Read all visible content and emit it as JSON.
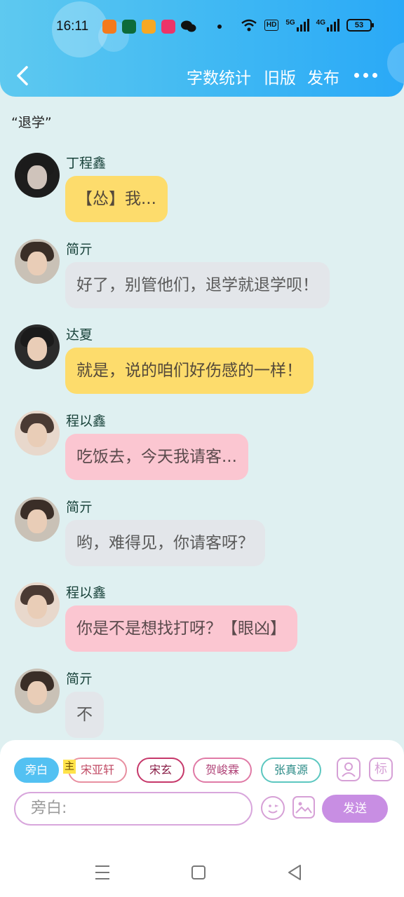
{
  "status_bar": {
    "time": "16:11",
    "network_5g": "5G",
    "network_4g": "4G",
    "hd": "HD",
    "battery": "53"
  },
  "header": {
    "word_count": "字数统计",
    "old_version": "旧版",
    "publish": "发布"
  },
  "chat_title": "“退学”",
  "messages": [
    {
      "sender": "丁程鑫",
      "text": "【怂】我...",
      "color": "yellow"
    },
    {
      "sender": "简亓",
      "text": "好了，别管他们，退学就退学呗！",
      "color": "gray"
    },
    {
      "sender": "达夏",
      "text": "就是，说的咱们好伤感的一样！",
      "color": "yellow"
    },
    {
      "sender": "程以鑫",
      "text": "吃饭去，今天我请客...",
      "color": "pink"
    },
    {
      "sender": "简亓",
      "text": "哟，难得见，你请客呀？",
      "color": "gray"
    },
    {
      "sender": "程以鑫",
      "text": "你是不是想找打呀？【眼凶】",
      "color": "pink"
    },
    {
      "sender": "简亓",
      "text": "不",
      "color": "gray"
    }
  ],
  "roles": {
    "narration": "旁白",
    "main_tag": "主",
    "role1": "宋亚轩",
    "role2": "宋玄",
    "role3": "贺峻霖",
    "role4": "张真源"
  },
  "tools": {
    "mark": "标"
  },
  "input": {
    "placeholder": "旁白:",
    "send": "发送"
  },
  "colors": {
    "header": "#3fb8f3",
    "yellow_bubble": "#fddc6c",
    "gray_bubble": "#e3e6ea",
    "pink_bubble": "#fbc6d1",
    "send_button": "#c88ee3"
  }
}
